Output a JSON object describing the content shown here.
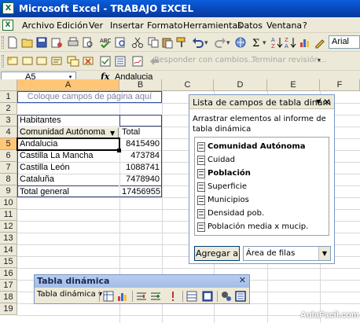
{
  "window": {
    "title": "Microsoft Excel - TRABAJO EXCEL",
    "app_icon": "excel-icon"
  },
  "menu": [
    "Archivo",
    "Edición",
    "Ver",
    "Insertar",
    "Formato",
    "Herramientas",
    "Datos",
    "Ventana",
    "?"
  ],
  "toolbar": {
    "font_name": "Arial",
    "reply_label": "Responder con cambios...",
    "end_review_label": "Terminar revisión..."
  },
  "formula_bar": {
    "name_box": "A5",
    "fx": "fx",
    "content": "Andalucia"
  },
  "sheet": {
    "columns": [
      "A",
      "B",
      "C",
      "D",
      "E",
      "F"
    ],
    "rows": [
      "1",
      "2",
      "3",
      "4",
      "5",
      "6",
      "7",
      "8",
      "9",
      "10",
      "11",
      "12",
      "13",
      "14",
      "15",
      "16",
      "17",
      "18",
      "19"
    ],
    "page_drop_hint": "Coloque campos de página aquí",
    "data_field": "Habitantes",
    "row_field": "Comunidad Autónoma",
    "value_header": "Total",
    "rows_data": [
      {
        "label": "Andalucia",
        "value": "8415490"
      },
      {
        "label": "Castilla La Mancha",
        "value": "473784"
      },
      {
        "label": "Castilla León",
        "value": "1088741"
      },
      {
        "label": "Cataluña",
        "value": "7478940"
      }
    ],
    "total_label": "Total general",
    "total_value": "17456955"
  },
  "field_list": {
    "title": "Lista de campos de tabla dinám",
    "description": "Arrastrar elementos al informe de tabla dinámica",
    "fields": [
      {
        "label": "Comunidad Autónoma",
        "bold": true
      },
      {
        "label": "Cuidad",
        "bold": false
      },
      {
        "label": "Población",
        "bold": true
      },
      {
        "label": "Superficie",
        "bold": false
      },
      {
        "label": "Municipios",
        "bold": false
      },
      {
        "label": "Densidad pob.",
        "bold": false
      },
      {
        "label": "Población media x mucip.",
        "bold": false
      }
    ],
    "add_button": "Agregar a",
    "area_select": "Área de filas"
  },
  "pivot_toolbar": {
    "title": "Tabla dinámica",
    "menu_label": "Tabla dinámica"
  },
  "watermark": "AulaFacil.com"
}
